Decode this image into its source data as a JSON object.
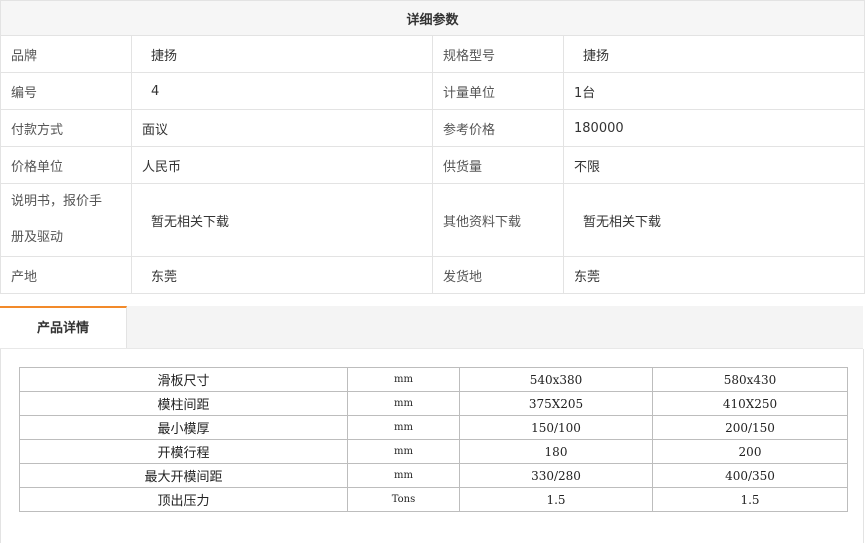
{
  "params": {
    "title": "详细参数",
    "rows": [
      [
        {
          "k": "品牌",
          "v": "捷扬"
        },
        {
          "k": "规格型号",
          "v": "捷扬"
        }
      ],
      [
        {
          "k": "编号",
          "v": "4"
        },
        {
          "k": "计量单位",
          "v": "1台"
        }
      ],
      [
        {
          "k": "付款方式",
          "v": "面议"
        },
        {
          "k": "参考价格",
          "v": "180000"
        }
      ],
      [
        {
          "k": "价格单位",
          "v": "人民币"
        },
        {
          "k": "供货量",
          "v": "不限"
        }
      ],
      [
        {
          "k1": "说明书，报价手",
          "k2": "册及驱动",
          "v": "暂无相关下载"
        },
        {
          "k": "其他资料下载",
          "v": "暂无相关下载"
        }
      ],
      [
        {
          "k": "产地",
          "v": "东莞"
        },
        {
          "k": "发货地",
          "v": "东莞"
        }
      ]
    ]
  },
  "tabs": {
    "active": "产品详情"
  },
  "spec": [
    [
      "滑板尺寸",
      "mm",
      "540x380",
      "580x430"
    ],
    [
      "模柱间距",
      "mm",
      "375X205",
      "410X250"
    ],
    [
      "最小模厚",
      "mm",
      "150/100",
      "200/150"
    ],
    [
      "开模行程",
      "mm",
      "180",
      "200"
    ],
    [
      "最大开模间距",
      "mm",
      "330/280",
      "400/350"
    ],
    [
      "顶出压力",
      "Tons",
      "1.5",
      "1.5"
    ]
  ]
}
